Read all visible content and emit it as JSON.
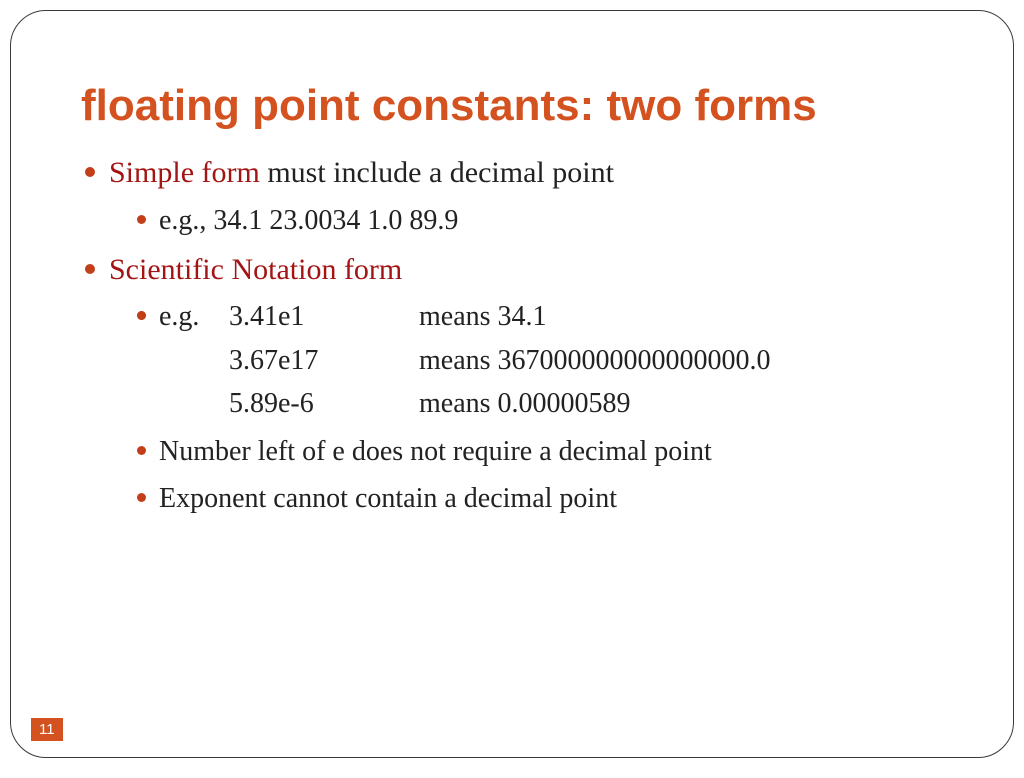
{
  "title": "floating point constants: two forms",
  "bullets": {
    "simple": {
      "label_hl": "Simple form",
      "label_rest": " must include a decimal point",
      "example": "e.g., 34.1   23.0034    1.0   89.9"
    },
    "scientific": {
      "label_hl": "Scientific Notation form",
      "examples_lead": "e.g.",
      "rows": [
        {
          "a": "3.41e1",
          "b": "means  34.1"
        },
        {
          "a": "3.67e17",
          "b": "means  367000000000000000.0"
        },
        {
          "a": "5.89e-6",
          "b": "means  0.00000589"
        }
      ],
      "notes": [
        "Number left of e does not require a decimal point",
        "Exponent cannot contain a decimal point"
      ]
    }
  },
  "page_number": "11"
}
